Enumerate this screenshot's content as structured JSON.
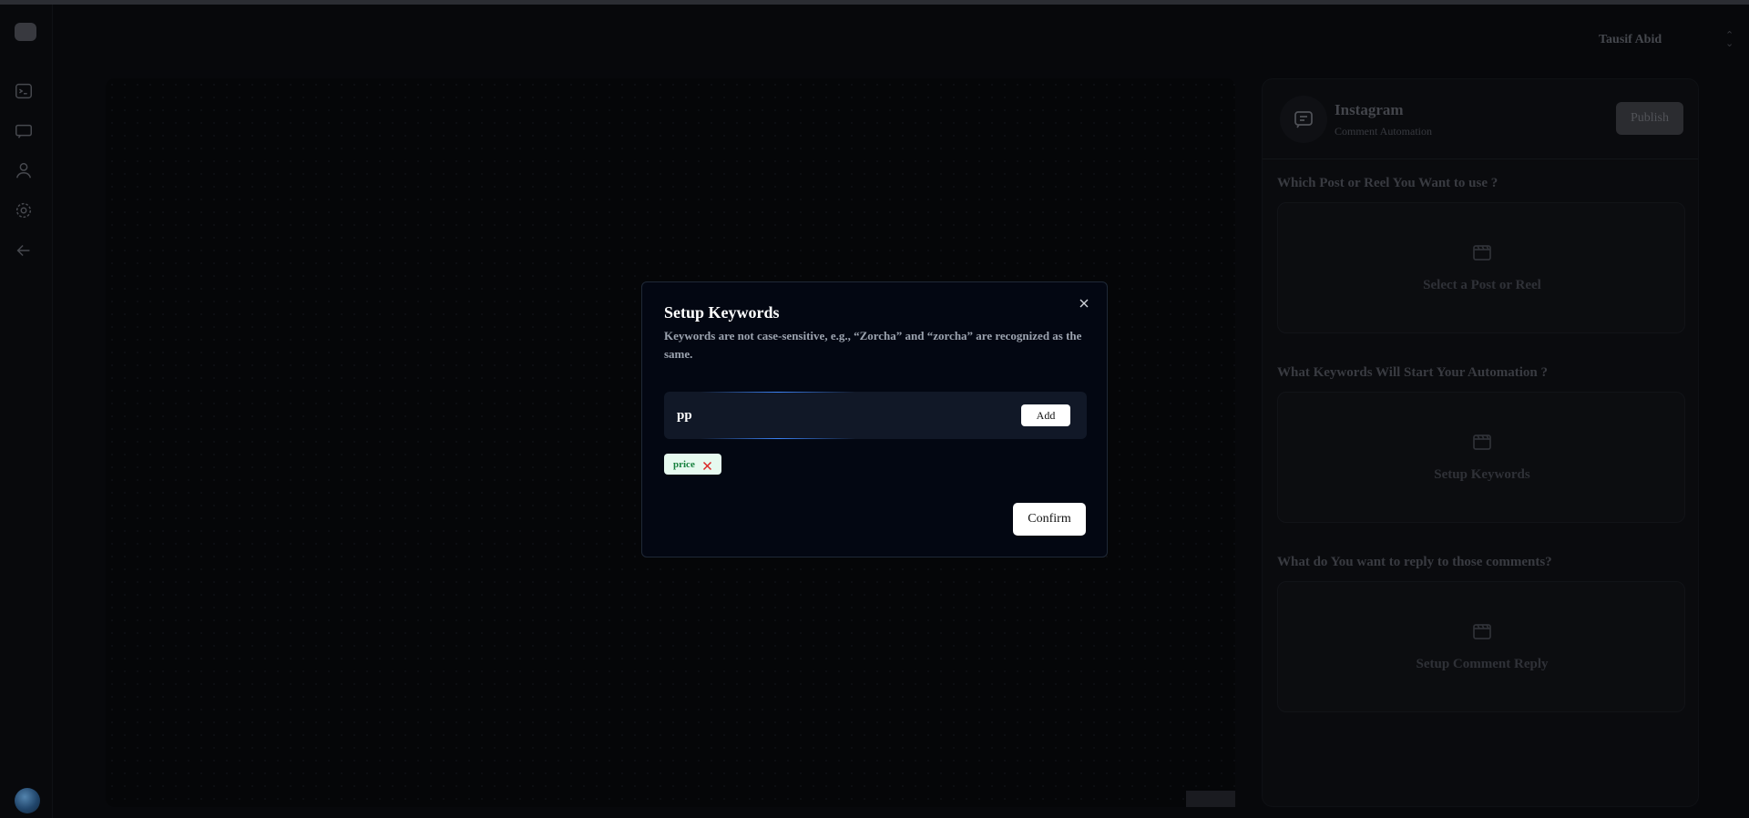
{
  "header": {
    "user_name": "Tausif Abid"
  },
  "sidebar": {
    "items": [
      {
        "icon": "terminal-icon"
      },
      {
        "icon": "chat-icon"
      },
      {
        "icon": "user-icon"
      },
      {
        "icon": "settings-icon"
      },
      {
        "icon": "back-arrow-icon"
      }
    ]
  },
  "panel": {
    "title": "Instagram",
    "subtitle": "Comment Automation",
    "publish_label": "Publish",
    "sections": [
      {
        "question": "Which Post or Reel You Want to use ?",
        "box_label": "Select a Post or Reel"
      },
      {
        "question": "What Keywords Will Start Your Automation ?",
        "box_label": "Setup Keywords"
      },
      {
        "question": "What do You want to reply to those comments?",
        "box_label": "Setup Comment Reply"
      }
    ]
  },
  "modal": {
    "title": "Setup Keywords",
    "description": "Keywords are not case-sensitive, e.g., “Zorcha” and “zorcha” are recognized as the same.",
    "input_value": "pp",
    "add_label": "Add",
    "keywords": [
      "price"
    ],
    "confirm_label": "Confirm"
  },
  "colors": {
    "background": "#0a0b0f",
    "modal_bg": "#030712",
    "chip_bg": "#e6f9ef",
    "chip_text": "#15803d",
    "chip_x": "#dc2626",
    "accent_glow": "#3b82f6"
  }
}
